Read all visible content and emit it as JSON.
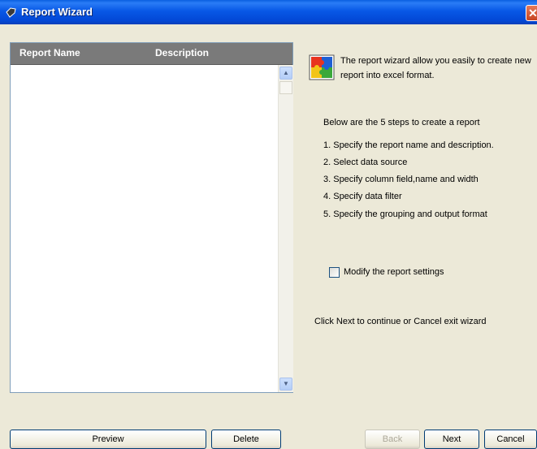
{
  "window": {
    "title": "Report Wizard",
    "close_glyph": "✕"
  },
  "list": {
    "columns": [
      "Report Name",
      "Description"
    ],
    "scroll_up_glyph": "▲",
    "scroll_down_glyph": "▼"
  },
  "info": {
    "intro": "The report wizard allow you easily to create new report into excel format.",
    "steps_header": "Below are the 5 steps to create a report",
    "steps": [
      "1. Specify the report name and description.",
      "2. Select data source",
      "3. Specify column field,name and width",
      "4. Specify data filter",
      "5. Specify the grouping and output format"
    ],
    "modify_checkbox": {
      "label": "Modify the report settings",
      "checked": false
    },
    "footer_note": "Click Next to continue or Cancel exit wizard"
  },
  "buttons": {
    "preview": "Preview",
    "delete": "Delete",
    "back": "Back",
    "next": "Next",
    "cancel": "Cancel"
  },
  "icons": {
    "title": "diamond-icon",
    "wizard": "puzzle-icon",
    "close": "close-icon"
  },
  "colors": {
    "title_bar": "#0858e6",
    "close_button": "#c74421",
    "list_header": "#7a7a7a",
    "dialog_bg": "#ece9d8",
    "puzzle_red": "#e8331f",
    "puzzle_blue": "#1f5fd4",
    "puzzle_yellow": "#f2c418",
    "puzzle_green": "#3aa83a"
  }
}
